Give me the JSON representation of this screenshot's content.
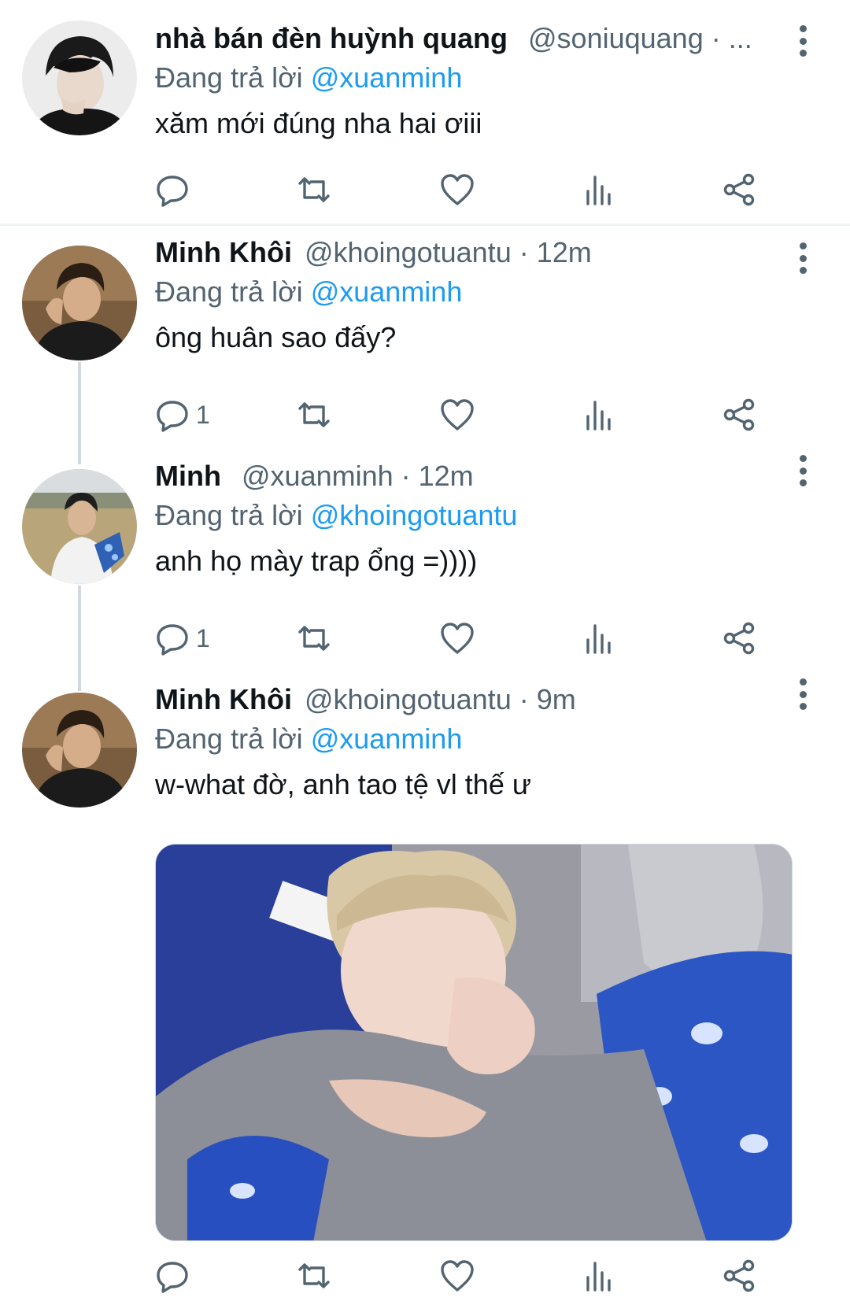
{
  "tweets": [
    {
      "name": "nhà bán đèn huỳnh quang",
      "handle": "@soniuquang · ...",
      "reply_prefix": "Đang trả lời",
      "reply_to": "@xuanminh",
      "text": "xăm mới đúng nha hai ơiii",
      "reply_count": ""
    },
    {
      "name": "Minh Khôi",
      "handle": "@khoingotuantu · 12m",
      "reply_prefix": "Đang trả lời",
      "reply_to": "@xuanminh",
      "text": "ông huân sao đấy?",
      "reply_count": "1"
    },
    {
      "name": "Minh",
      "handle": "@xuanminh · 12m",
      "reply_prefix": "Đang trả lời",
      "reply_to": "@khoingotuantu",
      "text": "anh họ mày trap ổng =))))",
      "reply_count": "1"
    },
    {
      "name": "Minh Khôi",
      "handle": "@khoingotuantu · 9m",
      "reply_prefix": "Đang trả lời",
      "reply_to": "@xuanminh",
      "text": "w-what đờ, anh tao tệ vl thế ư",
      "reply_count": ""
    }
  ],
  "icons": {
    "reply": "reply-icon",
    "retweet": "retweet-icon",
    "like": "heart-icon",
    "stats": "analytics-icon",
    "share": "share-icon",
    "more": "more-vertical-icon"
  },
  "colors": {
    "link": "#1d9bf0",
    "secondary_text": "#536471",
    "divider": "#eff3f4"
  }
}
